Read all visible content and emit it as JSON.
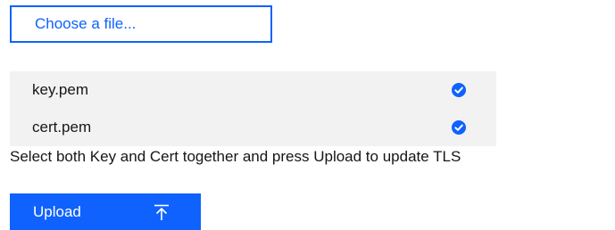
{
  "file_picker": {
    "button_label": "Choose a file..."
  },
  "files": [
    {
      "name": "key.pem",
      "status_icon": "checkmark-filled-icon"
    },
    {
      "name": "cert.pem",
      "status_icon": "checkmark-filled-icon"
    }
  ],
  "helper_text": "Select both Key and Cert together and press Upload to update TLS",
  "upload": {
    "label": "Upload",
    "icon": "upload-icon"
  },
  "colors": {
    "accent": "#0f62fe",
    "list_background": "#f2f2f2",
    "text": "#161616"
  }
}
